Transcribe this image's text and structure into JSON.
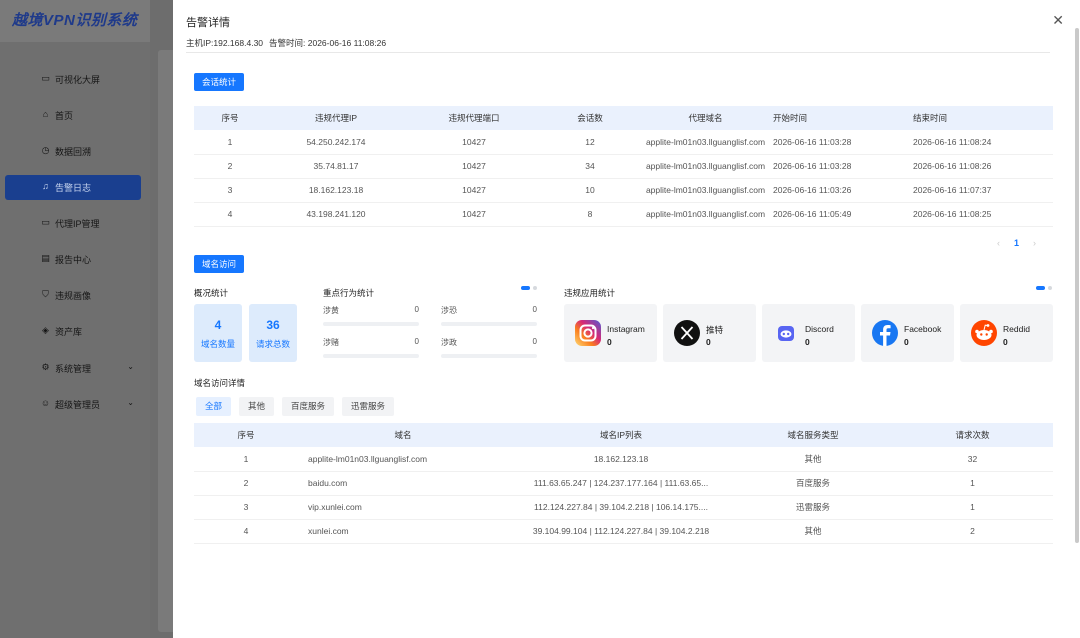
{
  "app": {
    "title": "越境VPN识别系统"
  },
  "sidebar": {
    "items": [
      {
        "label": "可视化大屏",
        "icon": "monitor-icon"
      },
      {
        "label": "首页",
        "icon": "home-icon"
      },
      {
        "label": "数据回溯",
        "icon": "clock-icon"
      },
      {
        "label": "告警日志",
        "icon": "bell-icon",
        "active": true
      },
      {
        "label": "代理IP管理",
        "icon": "monitor-icon"
      },
      {
        "label": "报告中心",
        "icon": "report-icon"
      },
      {
        "label": "违规画像",
        "icon": "shield-icon"
      },
      {
        "label": "资产库",
        "icon": "layers-icon"
      },
      {
        "label": "系统管理",
        "icon": "gear-icon",
        "expandable": true
      },
      {
        "label": "超级管理员",
        "icon": "user-icon",
        "expandable": true
      }
    ]
  },
  "drawer": {
    "title": "告警详情",
    "host_ip": "主机IP:192.168.4.30",
    "alert_time": "告警时间: 2026-06-16 11:08:26"
  },
  "session_stats": {
    "button": "会话统计",
    "headers": [
      "序号",
      "违规代理IP",
      "违规代理端口",
      "会话数",
      "代理域名",
      "开始时间",
      "结束时间"
    ],
    "rows": [
      [
        "1",
        "54.250.242.174",
        "10427",
        "12",
        "applite-lm01n03.llguanglisf.com",
        "2026-06-16 11:03:28",
        "2026-06-16 11:08:24"
      ],
      [
        "2",
        "35.74.81.17",
        "10427",
        "34",
        "applite-lm01n03.llguanglisf.com",
        "2026-06-16 11:03:28",
        "2026-06-16 11:08:26"
      ],
      [
        "3",
        "18.162.123.18",
        "10427",
        "10",
        "applite-lm01n03.llguanglisf.com",
        "2026-06-16 11:03:26",
        "2026-06-16 11:07:37"
      ],
      [
        "4",
        "43.198.241.120",
        "10427",
        "8",
        "applite-lm01n03.llguanglisf.com",
        "2026-06-16 11:05:49",
        "2026-06-16 11:08:25"
      ]
    ],
    "pagination": {
      "prev": "‹",
      "page": "1",
      "next": "›"
    }
  },
  "domain_access": {
    "button": "域名访问",
    "overview": {
      "title": "概况统计",
      "domains": {
        "value": "4",
        "label": "域名数量"
      },
      "requests": {
        "value": "36",
        "label": "请求总数"
      }
    },
    "behavior": {
      "title": "重点行为统计",
      "items": [
        {
          "label": "涉黄",
          "value": "0"
        },
        {
          "label": "涉恐",
          "value": "0"
        },
        {
          "label": "涉赌",
          "value": "0"
        },
        {
          "label": "涉政",
          "value": "0"
        }
      ]
    },
    "apps": {
      "title": "违规应用统计",
      "items": [
        {
          "name": "Instagram",
          "count": "0",
          "icon": "instagram-icon"
        },
        {
          "name": "推特",
          "count": "0",
          "icon": "x-twitter-icon"
        },
        {
          "name": "Discord",
          "count": "0",
          "icon": "discord-icon"
        },
        {
          "name": "Facebook",
          "count": "0",
          "icon": "facebook-icon"
        },
        {
          "name": "Reddid",
          "count": "0",
          "icon": "reddit-icon"
        }
      ]
    },
    "detail_title": "域名访问详情",
    "tabs": [
      "全部",
      "其他",
      "百度服务",
      "迅雷服务"
    ],
    "headers": [
      "序号",
      "域名",
      "域名IP列表",
      "域名服务类型",
      "请求次数"
    ],
    "rows": [
      [
        "1",
        "applite-lm01n03.llguanglisf.com",
        "18.162.123.18",
        "其他",
        "32"
      ],
      [
        "2",
        "baidu.com",
        "111.63.65.247  |  124.237.177.164  |  111.63.65...",
        "百度服务",
        "1"
      ],
      [
        "3",
        "vip.xunlei.com",
        "112.124.227.84  |  39.104.2.218  |  106.14.175....",
        "迅雷服务",
        "1"
      ],
      [
        "4",
        "xunlei.com",
        "39.104.99.104  |  112.124.227.84  |  39.104.2.218",
        "其他",
        "2"
      ]
    ]
  },
  "colors": {
    "primary": "#1677ff",
    "sidebar_active": "#1a3f8f",
    "header_bg": "#eaf1fd"
  }
}
